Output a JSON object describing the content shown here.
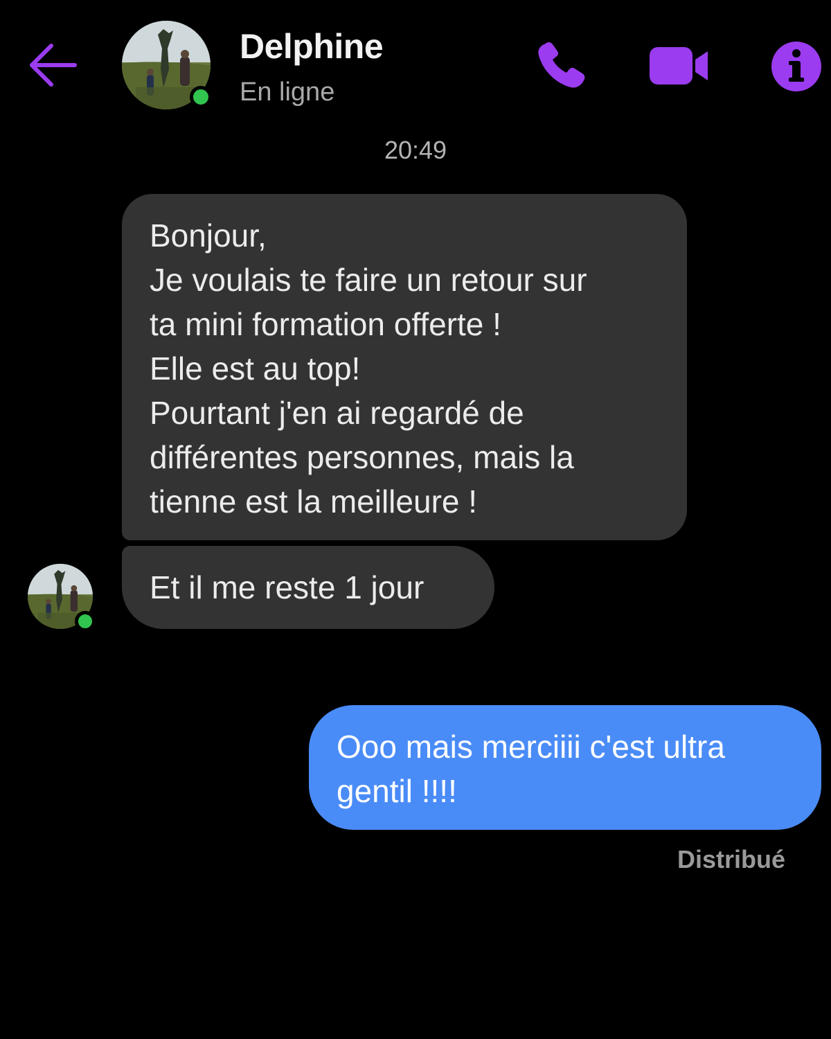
{
  "header": {
    "back_icon": "arrow-left-icon",
    "contact_name": "Delphine",
    "contact_status": "En ligne",
    "call_icon": "phone-icon",
    "video_icon": "video-camera-icon",
    "info_icon": "info-icon"
  },
  "colors": {
    "accent": "#9b3cf0",
    "background": "#000000",
    "incoming_bubble": "#333333",
    "outgoing_bubble": "#4a8cf7",
    "online": "#31c44f"
  },
  "conversation": {
    "timestamp": "20:49",
    "messages": [
      {
        "direction": "incoming",
        "lines": [
          "Bonjour,",
          "Je voulais te faire un retour sur",
          "ta mini formation offerte !",
          "Elle est au top!",
          "Pourtant j'en ai regardé de",
          "différentes personnes, mais la",
          "tienne est la meilleure !"
        ]
      },
      {
        "direction": "incoming",
        "text": "Et il me reste 1 jour"
      },
      {
        "direction": "outgoing",
        "lines": [
          "Ooo mais merciiii c'est ultra",
          "gentil !!!!"
        ]
      }
    ],
    "delivery_status": "Distribué"
  }
}
